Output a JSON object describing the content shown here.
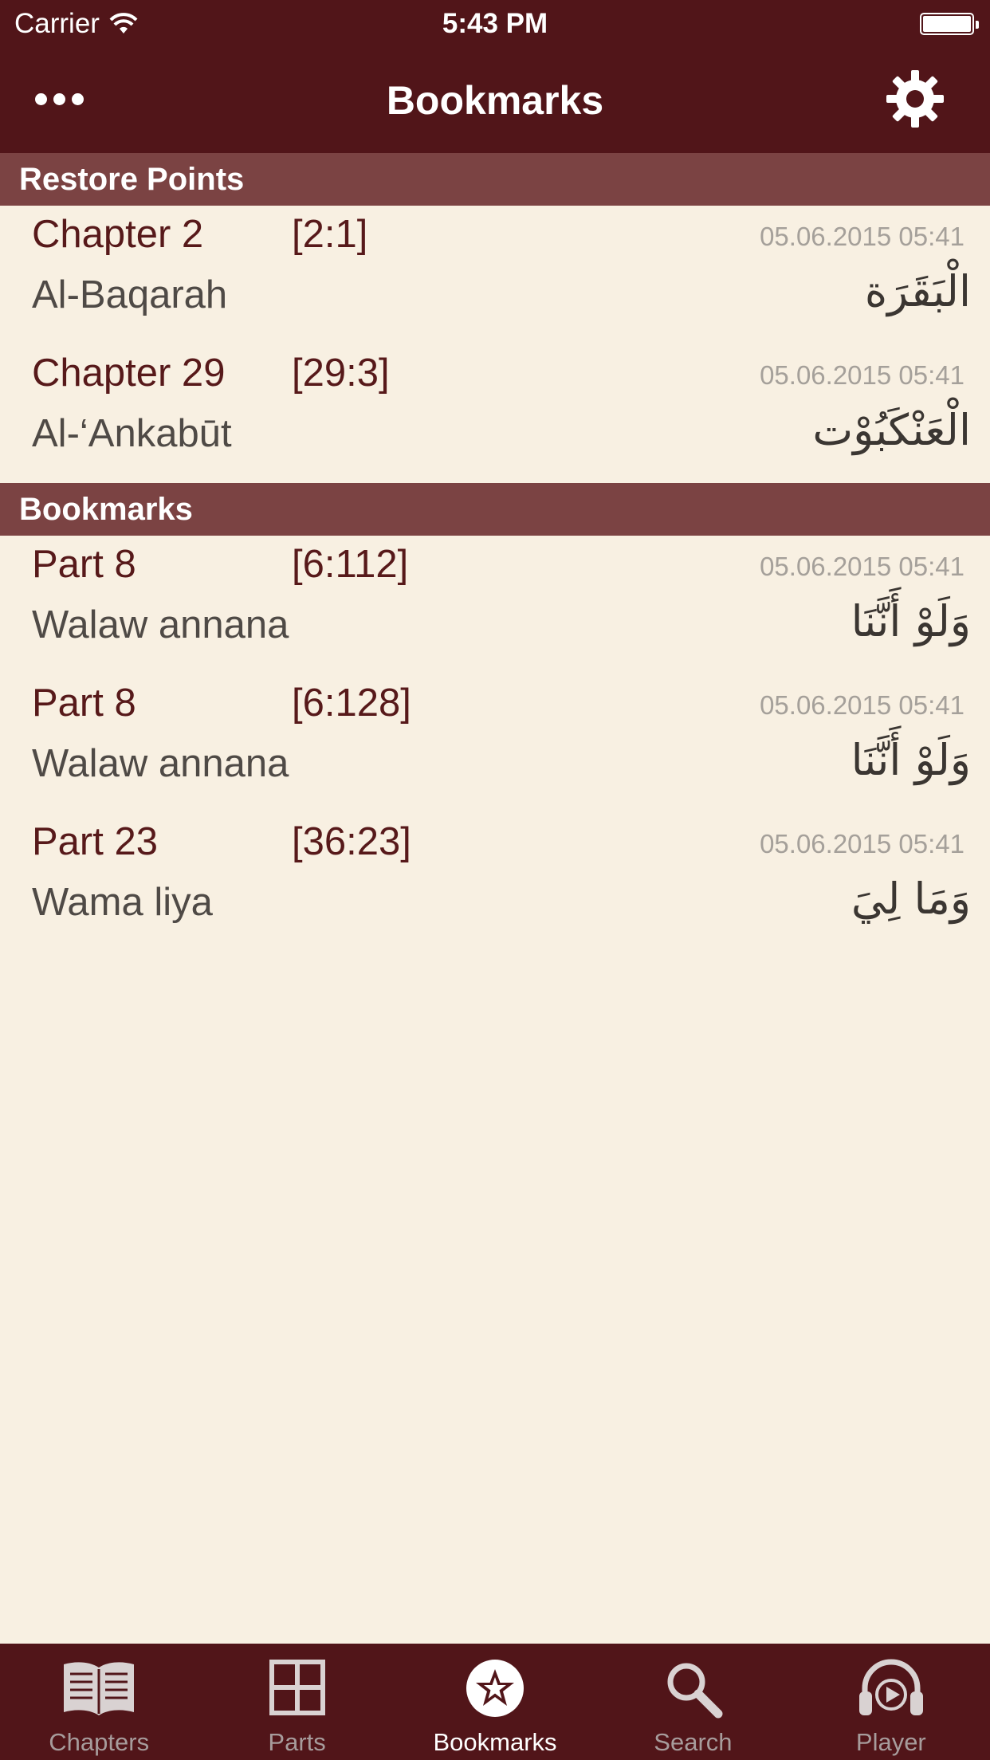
{
  "status_bar": {
    "carrier": "Carrier",
    "time": "5:43 PM"
  },
  "nav": {
    "title": "Bookmarks",
    "left_icon": "more-icon",
    "right_icon": "gear-icon"
  },
  "sections": [
    {
      "header": "Restore Points",
      "rows": [
        {
          "title": "Chapter 2",
          "ref": "[2:1]",
          "date": "05.06.2015 05:41",
          "sub": "Al-Baqarah",
          "arabic": "الْبَقَرَة"
        },
        {
          "title": "Chapter 29",
          "ref": "[29:3]",
          "date": "05.06.2015 05:41",
          "sub": "Al-‘Ankabūt",
          "arabic": "الْعَنْكَبُوْت"
        }
      ]
    },
    {
      "header": "Bookmarks",
      "rows": [
        {
          "title": "Part 8",
          "ref": "[6:112]",
          "date": "05.06.2015 05:41",
          "sub": "Walaw annana",
          "arabic": "وَلَوْ أَنَّنَا"
        },
        {
          "title": "Part 8",
          "ref": "[6:128]",
          "date": "05.06.2015 05:41",
          "sub": "Walaw annana",
          "arabic": "وَلَوْ أَنَّنَا"
        },
        {
          "title": "Part 23",
          "ref": "[36:23]",
          "date": "05.06.2015 05:41",
          "sub": "Wama liya",
          "arabic": "وَمَا لِيَ"
        }
      ]
    }
  ],
  "tabbar": {
    "items": [
      {
        "label": "Chapters",
        "icon": "book-icon",
        "active": false
      },
      {
        "label": "Parts",
        "icon": "grid-icon",
        "active": false
      },
      {
        "label": "Bookmarks",
        "icon": "star-icon",
        "active": true
      },
      {
        "label": "Search",
        "icon": "search-icon",
        "active": false
      },
      {
        "label": "Player",
        "icon": "headphones-icon",
        "active": false
      }
    ]
  },
  "colors": {
    "nav_bg": "#511519",
    "section_bg": "#7b4343",
    "page_bg": "#f8f0e2",
    "title_text": "#57191a"
  }
}
